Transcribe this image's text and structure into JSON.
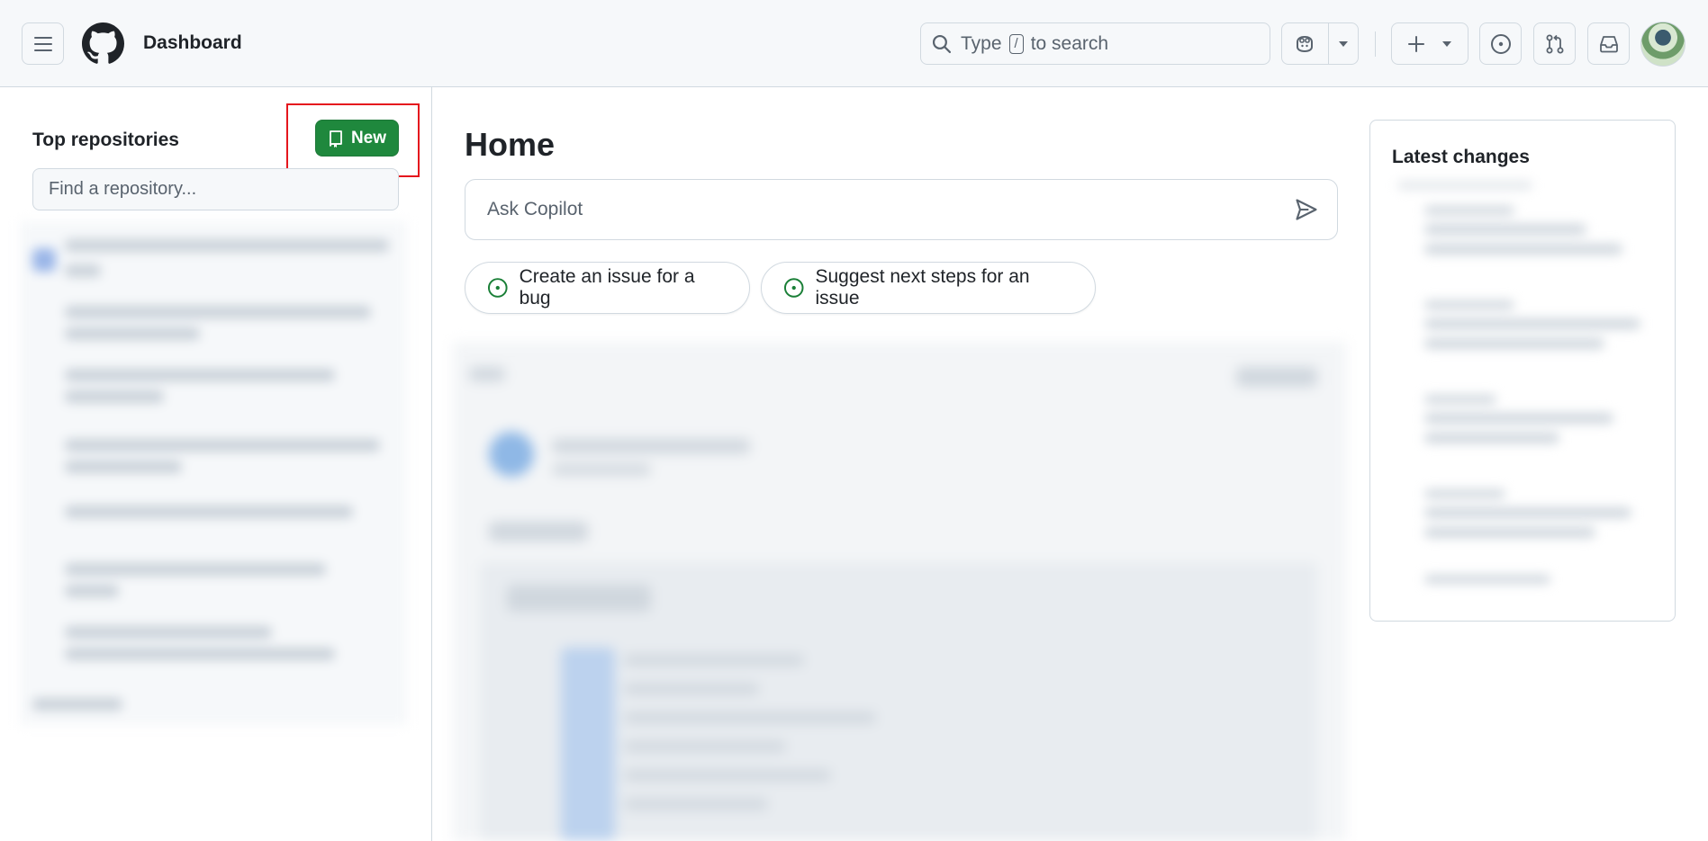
{
  "header": {
    "title": "Dashboard",
    "search": {
      "prefix": "Type",
      "key": "/",
      "suffix": "to search"
    }
  },
  "sidebar": {
    "heading": "Top repositories",
    "new_button": "New",
    "find_placeholder": "Find a repository..."
  },
  "main": {
    "title": "Home",
    "ask_placeholder": "Ask Copilot",
    "suggestions": [
      {
        "label": "Create an issue for a bug"
      },
      {
        "label": "Suggest next steps for an issue"
      }
    ]
  },
  "right_panel": {
    "title": "Latest changes"
  },
  "colors": {
    "accent_green": "#1f883d",
    "highlight_red": "#e5161d",
    "issue_green": "#1a7f37"
  }
}
